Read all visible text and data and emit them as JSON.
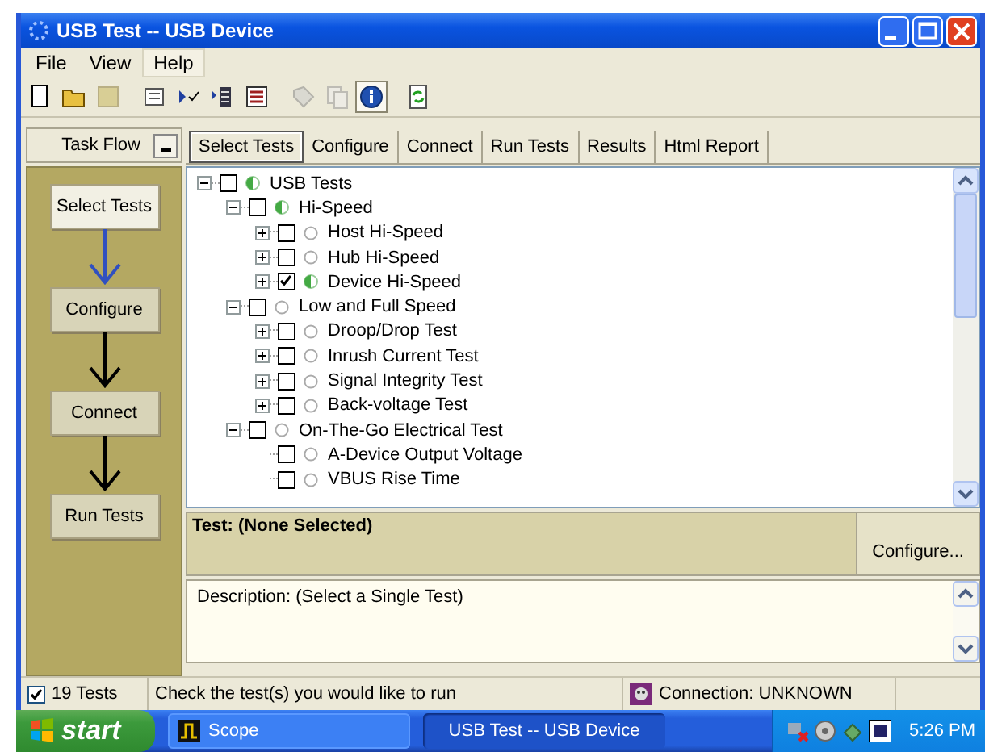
{
  "window": {
    "title": "USB Test -- USB Device"
  },
  "menu": [
    {
      "label": "File",
      "highlighted": false
    },
    {
      "label": "View",
      "highlighted": false
    },
    {
      "label": "Help",
      "highlighted": true
    }
  ],
  "toolbar": [
    {
      "pressed": false,
      "disabled": false
    },
    {
      "pressed": false,
      "disabled": false
    },
    {
      "pressed": false,
      "disabled": true
    },
    {
      "pressed": false,
      "disabled": false
    },
    {
      "pressed": false,
      "disabled": false
    },
    {
      "pressed": false,
      "disabled": false
    },
    {
      "pressed": false,
      "disabled": false
    },
    {
      "pressed": false,
      "disabled": true
    },
    {
      "pressed": false,
      "disabled": true
    },
    {
      "pressed": true,
      "disabled": false
    },
    {
      "pressed": false,
      "disabled": false
    }
  ],
  "task_flow": {
    "title": "Task Flow",
    "steps": [
      {
        "label": "Select Tests",
        "selected": true
      },
      {
        "label": "Configure",
        "selected": false
      },
      {
        "label": "Connect",
        "selected": false
      },
      {
        "label": "Run Tests",
        "selected": false
      }
    ]
  },
  "tabs": [
    {
      "label": "Select Tests",
      "selected": true
    },
    {
      "label": "Configure",
      "selected": false
    },
    {
      "label": "Connect",
      "selected": false
    },
    {
      "label": "Run Tests",
      "selected": false
    },
    {
      "label": "Results",
      "selected": false
    },
    {
      "label": "Html Report",
      "selected": false
    }
  ],
  "tree": [
    {
      "label": "USB Tests",
      "kind": "group",
      "expanded": true,
      "checked": false,
      "partial": true,
      "children": [
        {
          "label": "Hi-Speed",
          "kind": "group",
          "expanded": true,
          "checked": false,
          "partial": true,
          "children": [
            {
              "label": "Host Hi-Speed",
              "kind": "group",
              "expanded": false,
              "checked": false,
              "partial": false
            },
            {
              "label": "Hub Hi-Speed",
              "kind": "group",
              "expanded": false,
              "checked": false,
              "partial": false
            },
            {
              "label": "Device Hi-Speed",
              "kind": "group",
              "expanded": false,
              "checked": true,
              "partial": true
            }
          ]
        },
        {
          "label": "Low and Full Speed",
          "kind": "group",
          "expanded": true,
          "checked": false,
          "partial": false,
          "children": [
            {
              "label": "Droop/Drop Test",
              "kind": "group",
              "expanded": false,
              "checked": false,
              "partial": false
            },
            {
              "label": "Inrush Current Test",
              "kind": "group",
              "expanded": false,
              "checked": false,
              "partial": false
            },
            {
              "label": "Signal Integrity Test",
              "kind": "group",
              "expanded": false,
              "checked": false,
              "partial": false
            },
            {
              "label": "Back-voltage Test",
              "kind": "group",
              "expanded": false,
              "checked": false,
              "partial": false
            }
          ]
        },
        {
          "label": "On-The-Go Electrical Test",
          "kind": "group",
          "expanded": true,
          "checked": false,
          "partial": false,
          "children": [
            {
              "label": "A-Device Output Voltage",
              "kind": "leaf",
              "checked": false,
              "partial": false
            },
            {
              "label": "VBUS Rise Time",
              "kind": "leaf",
              "checked": false,
              "partial": false
            }
          ]
        }
      ]
    }
  ],
  "test_panel": {
    "label": "Test: (None Selected)",
    "button": "Configure..."
  },
  "description": "Description: (Select a Single Test)",
  "status_bar": {
    "tests": {
      "label": "19 Tests",
      "checked": true
    },
    "message": "Check the test(s) you would like to run",
    "connection": "Connection: UNKNOWN"
  },
  "taskbar": {
    "start": "start",
    "items": [
      {
        "label": "Scope",
        "selected": false
      },
      {
        "label": "USB Test -- USB Device",
        "selected": true
      }
    ],
    "clock": "5:26 PM"
  }
}
